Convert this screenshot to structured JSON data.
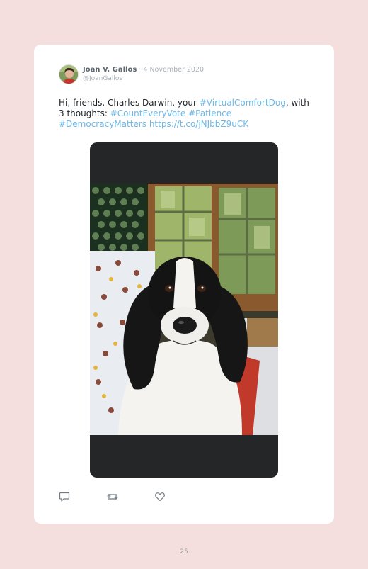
{
  "tweet": {
    "author_name": "Joan V. Gallos",
    "date_separator": " · ",
    "date": "4 November 2020",
    "handle": "@JoanGallos",
    "text_parts": {
      "intro": "Hi, friends. Charles Darwin, your ",
      "hashtag_virtualcomfortdog": "#VirtualComfortDog",
      "mid": ", with 3 thoughts: ",
      "hashtag_counteveryvote": "#CountEveryVote",
      "space1": " ",
      "hashtag_patience": "#Patience",
      "space2": " ",
      "hashtag_democracymatters": "#DemocracyMatters",
      "space3": " ",
      "link_url": "https://t.co/jNJbbZ9uCK"
    }
  },
  "actions": {
    "reply_icon": "reply-icon",
    "retweet_icon": "retweet-icon",
    "like_icon": "heart-icon"
  },
  "footer": {
    "page_number": "25"
  },
  "colors": {
    "page_background": "#f4dfde",
    "card_background": "#ffffff",
    "link": "#6bb8e8",
    "media_letterbox": "#252628"
  }
}
